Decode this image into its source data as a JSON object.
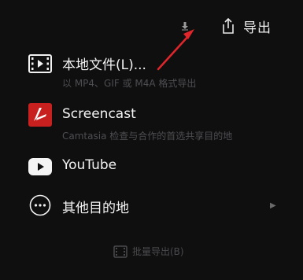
{
  "header": {
    "export_label": "导出"
  },
  "options": [
    {
      "title": "本地文件(L)...",
      "subtitle": "以 MP4、GIF 或 M4A 格式导出",
      "icon": "film-strip-icon"
    },
    {
      "title": "Screencast",
      "subtitle": "Camtasia 检查与合作的首选共享目的地",
      "icon": "screencast-logo-icon"
    },
    {
      "title": "YouTube",
      "subtitle": "",
      "icon": "youtube-logo-icon"
    },
    {
      "title": "其他目的地",
      "subtitle": "",
      "icon": "more-dots-icon",
      "has_submenu": true
    }
  ],
  "footer": {
    "batch_export_label": "批量导出(B)"
  },
  "colors": {
    "background": "#0f0f10",
    "annotation_arrow": "#e0262a",
    "screencast_red": "#c8201f"
  }
}
